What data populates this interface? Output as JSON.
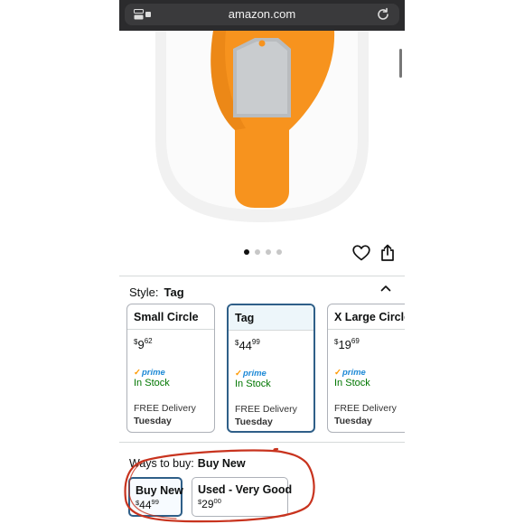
{
  "browser": {
    "url": "amazon.com"
  },
  "gallery": {
    "dot_count": 4,
    "active_index": 0
  },
  "style_selector": {
    "label": "Style:",
    "selected": "Tag",
    "options": [
      {
        "name": "Small Circle",
        "price_dollars": "9",
        "price_cents": "62",
        "prime": "prime",
        "stock": "In Stock",
        "delivery": "FREE Delivery",
        "delivery_day": "Tuesday",
        "selected": false
      },
      {
        "name": "Tag",
        "price_dollars": "44",
        "price_cents": "99",
        "prime": "prime",
        "stock": "In Stock",
        "delivery": "FREE Delivery",
        "delivery_day": "Tuesday",
        "selected": true
      },
      {
        "name": "X Large Circle",
        "price_dollars": "19",
        "price_cents": "69",
        "prime": "prime",
        "stock": "In Stock",
        "delivery": "FREE Delivery",
        "delivery_day": "Tuesday",
        "selected": false
      }
    ]
  },
  "ways_to_buy": {
    "label": "Ways to buy:",
    "selected": "Buy New",
    "options": [
      {
        "label": "Buy New",
        "price_dollars": "44",
        "price_cents": "99",
        "selected": true
      },
      {
        "label": "Used - Very Good",
        "price_dollars": "29",
        "price_cents": "00",
        "selected": false
      }
    ]
  },
  "currency_symbol": "$",
  "colors": {
    "selected_border": "#2f5f88",
    "in_stock": "#007600",
    "prime_blue": "#1f8ad6",
    "product_orange": "#f7931e",
    "annotation_red": "#c8331e"
  }
}
